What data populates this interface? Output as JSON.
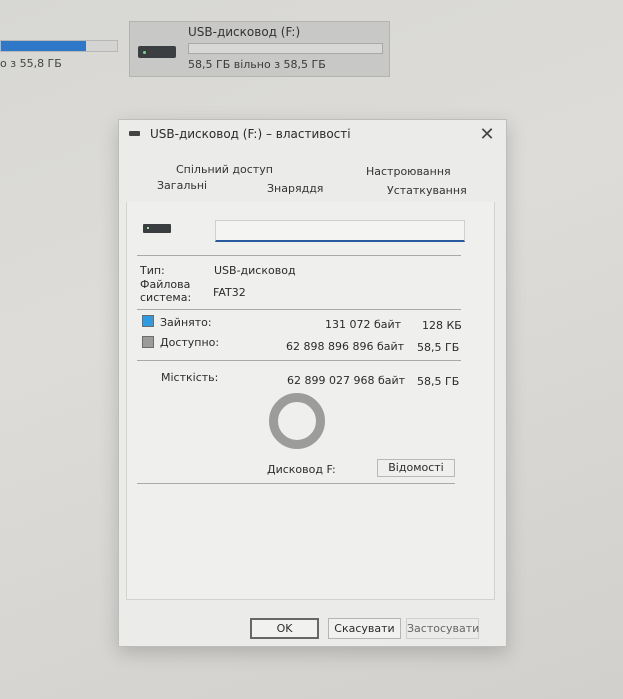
{
  "background": {
    "left_drive_text": "о з 55,8 ГБ",
    "left_drive_used_fraction": 0.73,
    "tile_title": "USB-дисковод (F:)",
    "tile_used_fraction": 0.0,
    "tile_subtitle": "58,5 ГБ вільно з 58,5 ГБ"
  },
  "dialog": {
    "title": "USB-дисковод (F:) – властивості",
    "close_symbol": "✕",
    "tabs": {
      "sharing": "Спільний доступ",
      "customize": "Настроювання",
      "general": "Загальні",
      "tools": "Знаряддя",
      "hardware": "Устаткування"
    },
    "name_field_value": "",
    "type_label": "Тип:",
    "type_value": "USB-дисковод",
    "fs_label_1": "Файлова",
    "fs_label_2": "система:",
    "fs_value": "FAT32",
    "used_label": "Зайнято:",
    "used_bytes": "131 072 байт",
    "used_size": "128 КБ",
    "free_label": "Доступно:",
    "free_bytes": "62 898 896 896 байт",
    "free_size": "58,5 ГБ",
    "capacity_label": "Місткість:",
    "capacity_bytes": "62 899 027 968 байт",
    "capacity_size": "58,5 ГБ",
    "drive_label": "Дисковод F:",
    "details_button": "Відомості",
    "ok_button": "OK",
    "cancel_button": "Скасувати",
    "apply_button": "Застосувати",
    "colors": {
      "used": "#2f9be0",
      "free": "#9c9c9a"
    }
  }
}
